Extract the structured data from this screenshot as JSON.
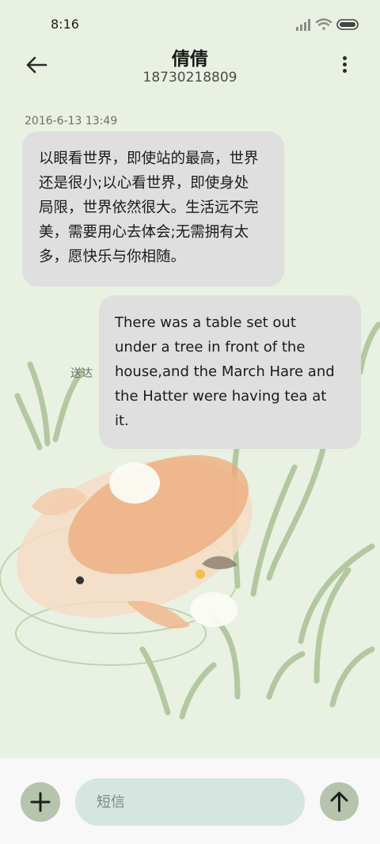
{
  "status_bar": {
    "time": "8:16",
    "icons": [
      "signal-icon",
      "wifi-icon",
      "battery-icon"
    ]
  },
  "header": {
    "contact_name": "倩倩",
    "contact_number": "18730218809",
    "back_icon": "back-arrow-icon",
    "more_icon": "more-vertical-icon"
  },
  "conversation": {
    "timestamp": "2016-6-13 13:49",
    "messages": [
      {
        "direction": "incoming",
        "lines": [
          "以眼看世界，即使站的最高，世界",
          "还是很小;以心看世界，即使身处",
          "局限，世界依然很大。生活远不完",
          "美，需要用心去体会;无需拥有太",
          "多，愿快乐与你相随。"
        ]
      },
      {
        "direction": "outgoing",
        "status": "送达",
        "lines": [
          "There was a table set out",
          "under a tree in front of the",
          "house,and the March Hare and",
          "the Hatter were having tea at",
          "it."
        ]
      }
    ]
  },
  "composer": {
    "placeholder": "短信",
    "value": "",
    "add_icon": "plus-icon",
    "send_icon": "send-arrow-up-icon"
  },
  "colors": {
    "background": "#e9f1e2",
    "bubble": "#dedfde",
    "button": "#b6c4ad",
    "input": "#d5e5df"
  }
}
